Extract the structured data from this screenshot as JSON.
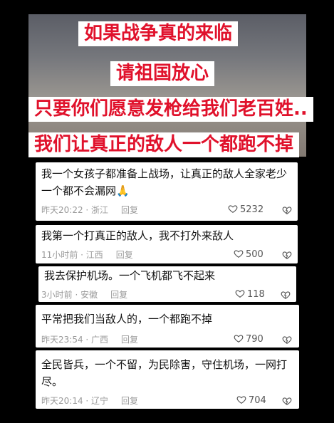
{
  "banner": {
    "line1": "如果战争真的来临",
    "line2": "请祖国放心",
    "line3": "只要你们愿意发枪给我们老百姓..",
    "line4": "我们让真正的敌人一个都跑不掉"
  },
  "comments": [
    {
      "text": "我一个女孩子都准备上战场，让真正的敌人全家老少一个都不会漏网🙏",
      "meta": "昨天20:22 · 浙江",
      "reply": "回复",
      "likes": "5232"
    },
    {
      "text": "我第一个打真正的敌人，我不打外来敌人",
      "meta": "11小时前 · 江西",
      "reply": "回复",
      "likes": "500"
    },
    {
      "text": "我去保护机场。一个飞机都飞不起来",
      "meta": "3小时前 · 安徽",
      "reply": "回复",
      "likes": "118"
    },
    {
      "text": "平常把我们当敌人的，一个都跑不掉",
      "meta": "昨天23:54 · 广西",
      "reply": "回复",
      "likes": "790"
    },
    {
      "text": "全民皆兵，一个不留，为民除害，守住机场，一网打尽。",
      "meta": "昨天20:14 · 辽宁",
      "reply": "回复",
      "likes": "704"
    }
  ]
}
